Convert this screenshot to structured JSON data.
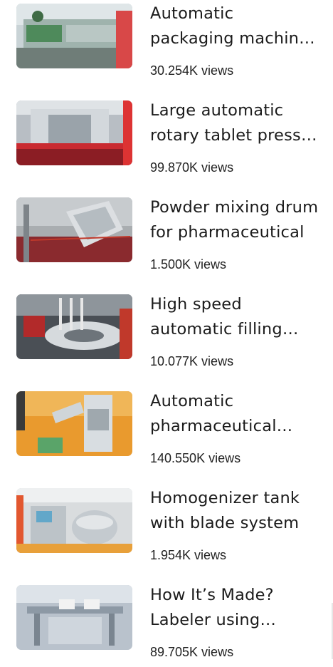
{
  "videos": [
    {
      "title": "Automatic packaging machine for blister",
      "views": "30.254K views",
      "thumb": "packaging-machine"
    },
    {
      "title": "Large automatic rotary tablet press machine",
      "views": "99.870K views",
      "thumb": "tablet-press"
    },
    {
      "title": "Powder mixing drum for pharmaceutical",
      "views": "1.500K views",
      "thumb": "mixing-drum"
    },
    {
      "title": "High speed automatic filling machine",
      "views": "10.077K views",
      "thumb": "filling-machine"
    },
    {
      "title": "Automatic pharmaceutical coating machine",
      "views": "140.550K views",
      "thumb": "pharma-machine"
    },
    {
      "title": "Homogenizer tank with blade system",
      "views": "1.954K views",
      "thumb": "homogenizer-tank"
    },
    {
      "title": "How It’s Made? Labeler using automatic",
      "views": "89.705K views",
      "thumb": "labeler"
    }
  ]
}
